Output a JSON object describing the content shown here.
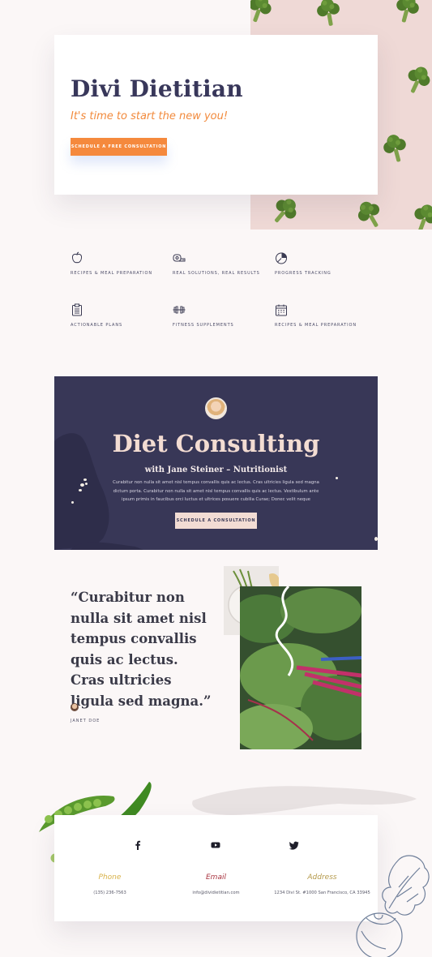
{
  "hero": {
    "title": "Divi Dietitian",
    "tagline": "It's time to start the new you!",
    "cta_label": "Schedule a free consultation"
  },
  "features": [
    {
      "label": "Recipes & Meal Preparation",
      "icon": "apple-icon"
    },
    {
      "label": "Real Solutions, Real Results",
      "icon": "measuring-tape-icon"
    },
    {
      "label": "Progress Tracking",
      "icon": "pie-chart-icon"
    },
    {
      "label": "Actionable Plans",
      "icon": "clipboard-list-icon"
    },
    {
      "label": "Fitness Supplements",
      "icon": "dumbbell-icon"
    },
    {
      "label": "Recipes & Meal Preparation",
      "icon": "calendar-icon"
    }
  ],
  "consulting": {
    "title": "Diet Consulting",
    "subtitle": "with Jane Steiner – Nutritionist",
    "body": "Curabitur non nulla sit amet nisl tempus convallis quis ac lectus. Cras ultricies ligula sed magna dictum porta. Curabitur non nulla sit amet nisl tempus convallis quis ac lectus. Vestibulum ante ipsum primis in faucibus orci luctus et ultrices posuere cubilia Curae; Donec velit neque",
    "cta_label": "Schedule a consultation"
  },
  "testimonial": {
    "quote": "“Curabitur non nulla sit amet nisl tempus convallis quis ac lectus. Cras ultricies ligula sed magna.”",
    "author": "JANET DOE"
  },
  "contact": {
    "social": [
      "facebook-icon",
      "youtube-icon",
      "twitter-icon"
    ],
    "columns": [
      {
        "heading": "Phone",
        "value": "(135) 236-7563",
        "color": "#d8b24a"
      },
      {
        "heading": "Email",
        "value": "info@dividietitian.com",
        "color": "#a8323e"
      },
      {
        "heading": "Address",
        "value": "1234 Divi St. #1000 San Francisco, CA 33945",
        "color": "#b59a4c"
      }
    ]
  },
  "colors": {
    "brand_navy": "#383757",
    "accent_orange": "#f5893d",
    "blush": "#f2dcd4",
    "background": "#fbf7f7"
  }
}
